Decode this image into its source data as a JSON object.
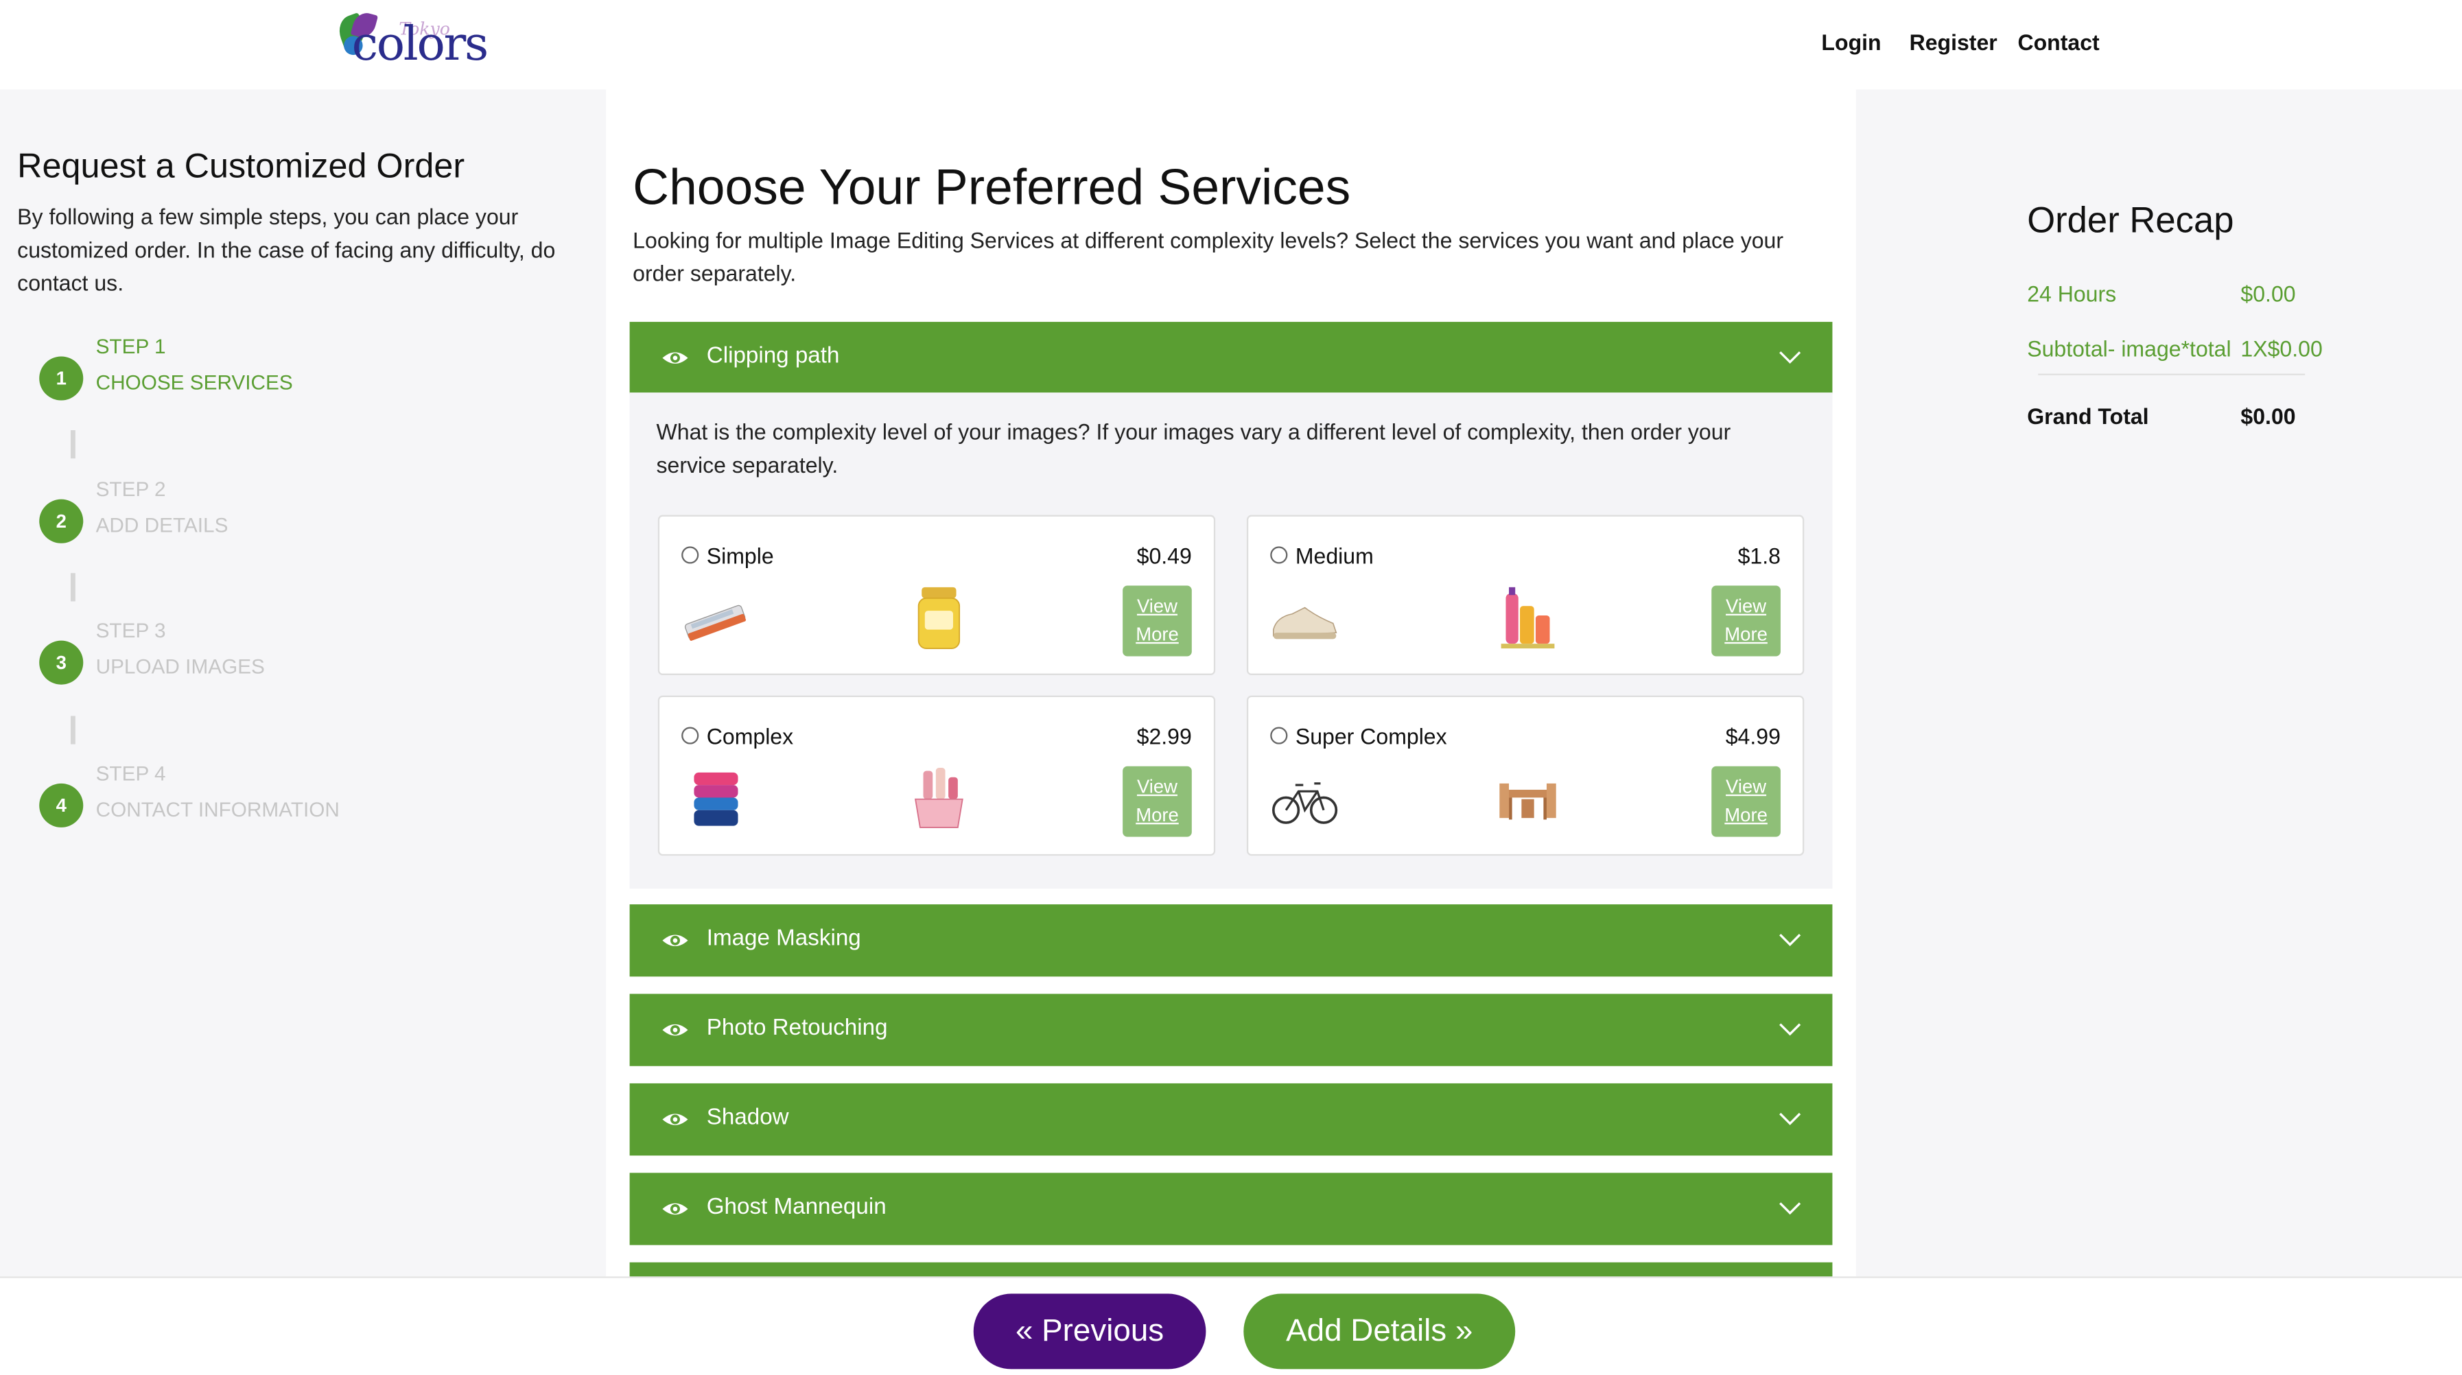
{
  "header": {
    "logo_text": "colors",
    "logo_script": "Tokyo",
    "nav": [
      "Login",
      "Register",
      "Contact"
    ]
  },
  "sidebar": {
    "title": "Request a Customized Order",
    "description": "By following a few simple steps, you can place your customized order. In the case of facing any difficulty, do contact us.",
    "steps": [
      {
        "num": "1",
        "label": "STEP 1",
        "name": "CHOOSE SERVICES",
        "active": true
      },
      {
        "num": "2",
        "label": "STEP 2",
        "name": "ADD DETAILS",
        "active": false
      },
      {
        "num": "3",
        "label": "STEP 3",
        "name": "UPLOAD IMAGES",
        "active": false
      },
      {
        "num": "4",
        "label": "STEP 4",
        "name": "CONTACT INFORMATION",
        "active": false
      }
    ]
  },
  "main": {
    "title": "Choose Your Preferred Services",
    "intro": "Looking for multiple Image Editing Services at different complexity levels? Select the services you want and place your order separately.",
    "accordion": [
      {
        "label": "Clipping path",
        "expanded": true
      },
      {
        "label": "Image Masking",
        "expanded": false
      },
      {
        "label": "Photo Retouching",
        "expanded": false
      },
      {
        "label": "Shadow",
        "expanded": false
      },
      {
        "label": "Ghost Mannequin",
        "expanded": false
      }
    ],
    "question": "What is the complexity level of your images? If your images vary a different level of complexity, then order your service separately.",
    "options": [
      {
        "name": "Simple",
        "price": "$0.49",
        "view_more_1": "View",
        "view_more_2": "More"
      },
      {
        "name": "Medium",
        "price": "$1.8",
        "view_more_1": "View",
        "view_more_2": "More"
      },
      {
        "name": "Complex",
        "price": "$2.99",
        "view_more_1": "View",
        "view_more_2": "More"
      },
      {
        "name": "Super Complex",
        "price": "$4.99",
        "view_more_1": "View",
        "view_more_2": "More"
      }
    ]
  },
  "recap": {
    "title": "Order Recap",
    "turnaround_label": "24 Hours",
    "turnaround_value": "$0.00",
    "subtotal_label": "Subtotal- image*total",
    "subtotal_value": "1X$0.00",
    "grand_total_label": "Grand Total",
    "grand_total_value": "$0.00"
  },
  "footer": {
    "previous_label": "« Previous",
    "next_label": "Add Details »"
  },
  "colors": {
    "brand_green": "#5a9e32",
    "brand_purple": "#4a0e7c",
    "view_more_green": "#8fbf78"
  }
}
